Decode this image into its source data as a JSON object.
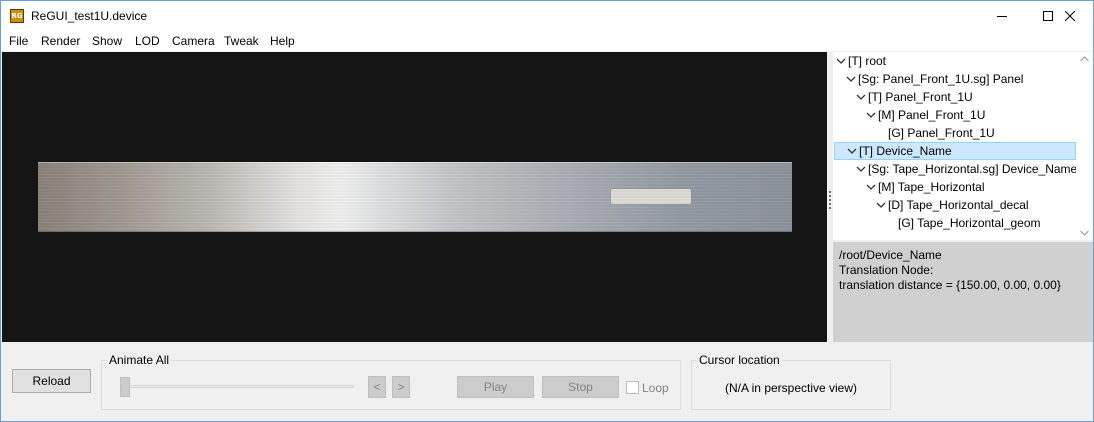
{
  "window": {
    "title": "ReGUI_test1U.device",
    "icon_text": "RG"
  },
  "menu": {
    "items": [
      "File",
      "Render",
      "Show",
      "LOD",
      "Camera",
      "Tweak",
      "Help"
    ]
  },
  "tree": {
    "nodes": [
      {
        "label": "[T] root",
        "expanded": true
      },
      {
        "label": "[Sg: Panel_Front_1U.sg] Panel",
        "expanded": true
      },
      {
        "label": "[T] Panel_Front_1U",
        "expanded": true
      },
      {
        "label": "[M] Panel_Front_1U",
        "expanded": true
      },
      {
        "label": "[G] Panel_Front_1U",
        "expanded": false
      },
      {
        "label": "[T] Device_Name",
        "expanded": true,
        "selected": true
      },
      {
        "label": "[Sg: Tape_Horizontal.sg] Device_Name",
        "expanded": true
      },
      {
        "label": "[M] Tape_Horizontal",
        "expanded": true
      },
      {
        "label": "[D] Tape_Horizontal_decal",
        "expanded": true
      },
      {
        "label": "[G] Tape_Horizontal_geom",
        "expanded": false
      }
    ]
  },
  "info": {
    "path": "/root/Device_Name",
    "node_type": "Translation Node:",
    "detail": "translation distance = {150.00, 0.00, 0.00}"
  },
  "controls": {
    "reload_label": "Reload",
    "animate_group_title": "Animate All",
    "prev_label": "<",
    "next_label": ">",
    "play_label": "Play",
    "stop_label": "Stop",
    "loop_label": "Loop",
    "loop_checked": false,
    "animation_position": 0,
    "cursor_group_title": "Cursor location",
    "cursor_text": "(N/A in perspective view)"
  },
  "colors": {
    "selection_bg": "#cce8ff",
    "viewport_bg": "#151515",
    "info_bg": "#d0d0d0"
  }
}
